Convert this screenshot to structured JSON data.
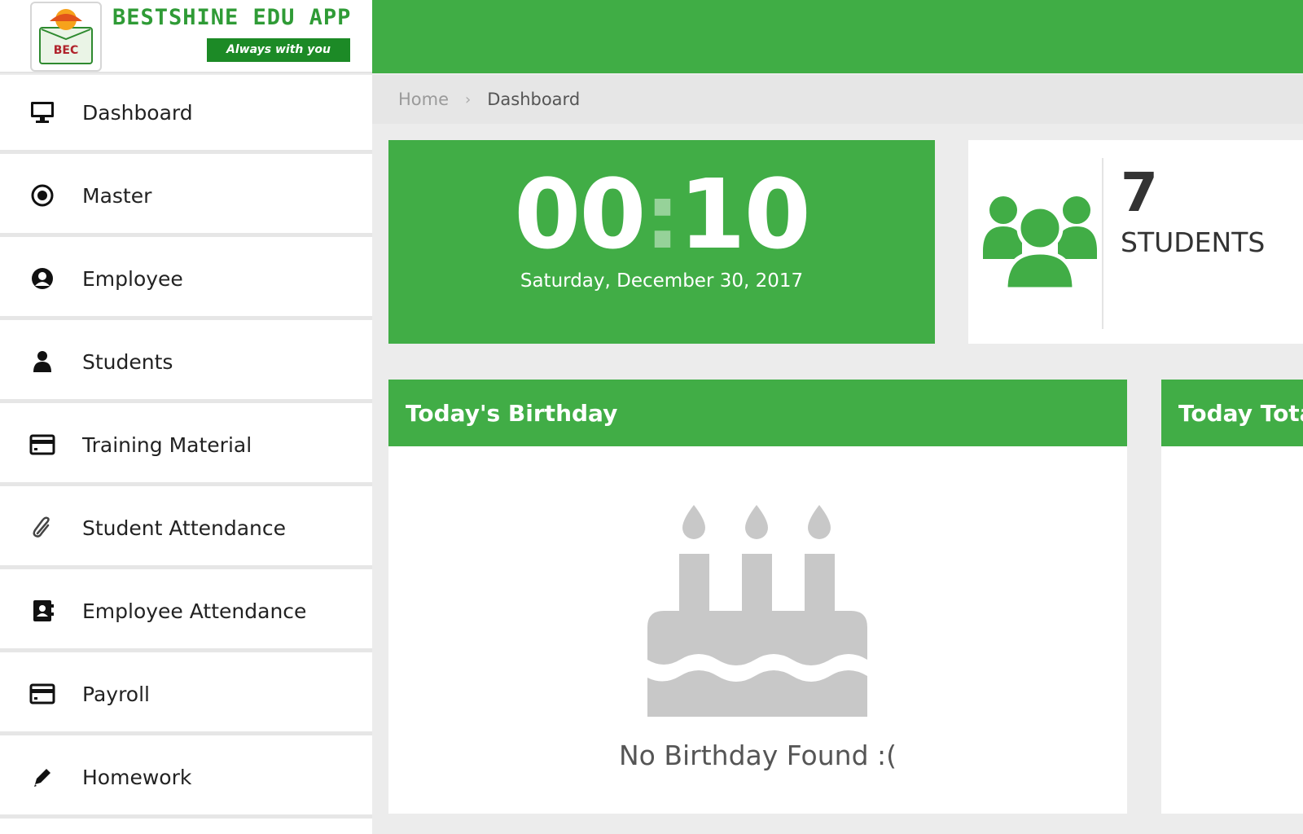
{
  "brand": {
    "logo_text": "BEC",
    "title": "BESTSHINE EDU APP",
    "tagline": "Always with you"
  },
  "sidebar": {
    "items": [
      {
        "label": "Dashboard",
        "icon": "monitor-icon"
      },
      {
        "label": "Master",
        "icon": "radio-dot-icon"
      },
      {
        "label": "Employee",
        "icon": "user-circle-icon"
      },
      {
        "label": "Students",
        "icon": "person-icon"
      },
      {
        "label": "Training Material",
        "icon": "credit-card-icon"
      },
      {
        "label": "Student Attendance",
        "icon": "paperclip-icon"
      },
      {
        "label": "Employee Attendance",
        "icon": "contact-book-icon"
      },
      {
        "label": "Payroll",
        "icon": "credit-card-icon"
      },
      {
        "label": "Homework",
        "icon": "pencil-icon"
      }
    ]
  },
  "breadcrumb": {
    "home": "Home",
    "separator": "›",
    "current": "Dashboard"
  },
  "clock": {
    "hours": "00",
    "separator": ":",
    "minutes": "10",
    "date": "Saturday, December 30, 2017"
  },
  "stats": {
    "students_count": "7",
    "students_label": "STUDENTS",
    "icon": "group-users-icon"
  },
  "panels": {
    "birthday_title": "Today's Birthday",
    "birthday_empty": "No Birthday Found :(",
    "birthday_icon": "birthday-cake-icon",
    "total_title": "Today Total"
  },
  "colors": {
    "accent_green": "#41ad46",
    "dark_green": "#1c8a26"
  }
}
